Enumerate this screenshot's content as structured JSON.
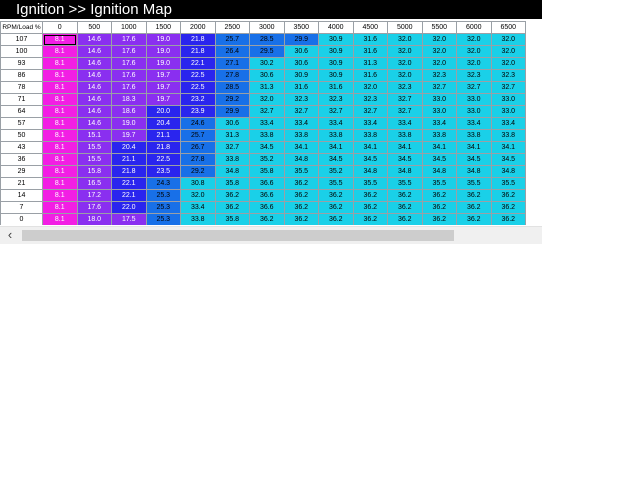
{
  "window": {
    "title": "Ignition >> Ignition Map"
  },
  "table": {
    "corner_label": "RPM/Load %",
    "columns": [
      "0",
      "500",
      "1000",
      "1500",
      "2000",
      "2500",
      "3000",
      "3500",
      "4000",
      "4500",
      "5000",
      "5500",
      "6000",
      "6500"
    ],
    "rows": [
      {
        "label": "107",
        "values": [
          "8.1",
          "14.6",
          "17.6",
          "19.0",
          "21.8",
          "25.7",
          "28.5",
          "29.9",
          "30.9",
          "31.6",
          "32.0",
          "32.0",
          "32.0",
          "32.0"
        ]
      },
      {
        "label": "100",
        "values": [
          "8.1",
          "14.6",
          "17.6",
          "19.0",
          "21.8",
          "26.4",
          "29.5",
          "30.6",
          "30.9",
          "31.6",
          "32.0",
          "32.0",
          "32.0",
          "32.0"
        ]
      },
      {
        "label": "93",
        "values": [
          "8.1",
          "14.6",
          "17.6",
          "19.0",
          "22.1",
          "27.1",
          "30.2",
          "30.6",
          "30.9",
          "31.3",
          "32.0",
          "32.0",
          "32.0",
          "32.0"
        ]
      },
      {
        "label": "86",
        "values": [
          "8.1",
          "14.6",
          "17.6",
          "19.7",
          "22.5",
          "27.8",
          "30.6",
          "30.9",
          "30.9",
          "31.6",
          "32.0",
          "32.3",
          "32.3",
          "32.3"
        ]
      },
      {
        "label": "78",
        "values": [
          "8.1",
          "14.6",
          "17.6",
          "19.7",
          "22.5",
          "28.5",
          "31.3",
          "31.6",
          "31.6",
          "32.0",
          "32.3",
          "32.7",
          "32.7",
          "32.7"
        ]
      },
      {
        "label": "71",
        "values": [
          "8.1",
          "14.6",
          "18.3",
          "19.7",
          "23.2",
          "29.2",
          "32.0",
          "32.3",
          "32.3",
          "32.3",
          "32.7",
          "33.0",
          "33.0",
          "33.0"
        ]
      },
      {
        "label": "64",
        "values": [
          "8.1",
          "14.6",
          "18.6",
          "20.0",
          "23.9",
          "29.9",
          "32.7",
          "32.7",
          "32.7",
          "32.7",
          "32.7",
          "33.0",
          "33.0",
          "33.0"
        ]
      },
      {
        "label": "57",
        "values": [
          "8.1",
          "14.6",
          "19.0",
          "20.4",
          "24.6",
          "30.6",
          "33.4",
          "33.4",
          "33.4",
          "33.4",
          "33.4",
          "33.4",
          "33.4",
          "33.4"
        ]
      },
      {
        "label": "50",
        "values": [
          "8.1",
          "15.1",
          "19.7",
          "21.1",
          "25.7",
          "31.3",
          "33.8",
          "33.8",
          "33.8",
          "33.8",
          "33.8",
          "33.8",
          "33.8",
          "33.8"
        ]
      },
      {
        "label": "43",
        "values": [
          "8.1",
          "15.5",
          "20.4",
          "21.8",
          "26.7",
          "32.7",
          "34.5",
          "34.1",
          "34.1",
          "34.1",
          "34.1",
          "34.1",
          "34.1",
          "34.1"
        ]
      },
      {
        "label": "36",
        "values": [
          "8.1",
          "15.5",
          "21.1",
          "22.5",
          "27.8",
          "33.8",
          "35.2",
          "34.8",
          "34.5",
          "34.5",
          "34.5",
          "34.5",
          "34.5",
          "34.5"
        ]
      },
      {
        "label": "29",
        "values": [
          "8.1",
          "15.8",
          "21.8",
          "23.5",
          "29.2",
          "34.8",
          "35.8",
          "35.5",
          "35.2",
          "34.8",
          "34.8",
          "34.8",
          "34.8",
          "34.8"
        ]
      },
      {
        "label": "21",
        "values": [
          "8.1",
          "16.5",
          "22.1",
          "24.3",
          "30.8",
          "35.8",
          "36.6",
          "36.2",
          "35.5",
          "35.5",
          "35.5",
          "35.5",
          "35.5",
          "35.5"
        ]
      },
      {
        "label": "14",
        "values": [
          "8.1",
          "17.2",
          "22.1",
          "25.3",
          "32.0",
          "36.2",
          "36.6",
          "36.2",
          "36.2",
          "36.2",
          "36.2",
          "36.2",
          "36.2",
          "36.2"
        ]
      },
      {
        "label": "7",
        "values": [
          "8.1",
          "17.6",
          "22.0",
          "25.3",
          "33.4",
          "36.2",
          "36.6",
          "36.2",
          "36.2",
          "36.2",
          "36.2",
          "36.2",
          "36.2",
          "36.2"
        ]
      },
      {
        "label": "0",
        "values": [
          "8.1",
          "18.0",
          "17.5",
          "25.3",
          "33.8",
          "35.8",
          "36.2",
          "36.2",
          "36.2",
          "36.2",
          "36.2",
          "36.2",
          "36.2",
          "36.2"
        ]
      }
    ],
    "selected_cell": {
      "row": 0,
      "col": 0
    },
    "colors": {
      "low": "#f21ee4",
      "mid_low": "#8a2ff0",
      "mid": "#2a25ee",
      "mid_high": "#1870e8",
      "high": "#1ad0e8"
    }
  },
  "scrollbar": {
    "left_arrow_icon": "chevron-left-icon"
  }
}
